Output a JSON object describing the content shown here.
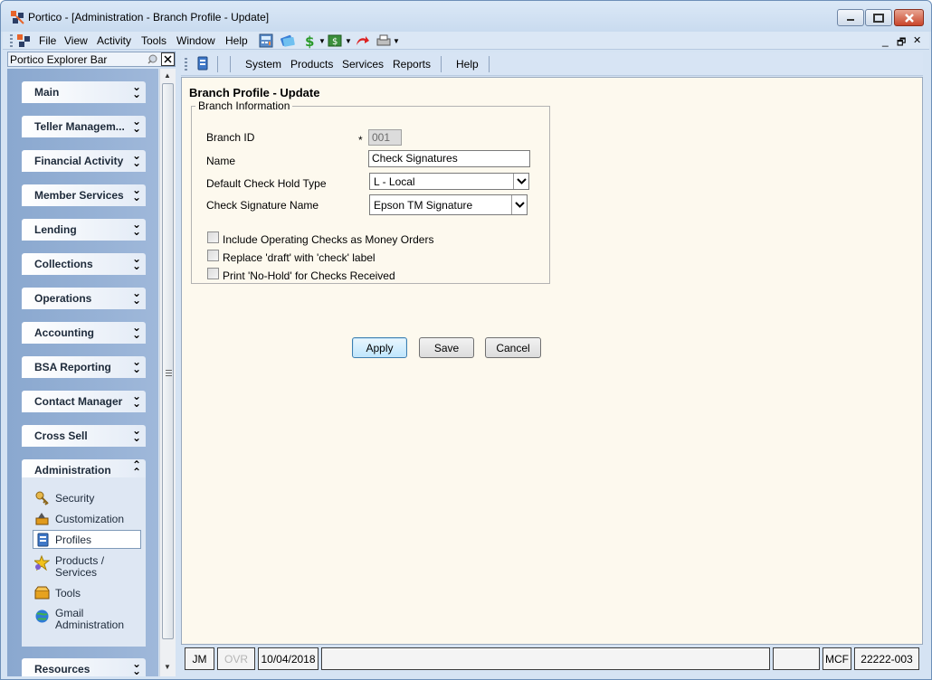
{
  "window": {
    "title": "Portico - [Administration - Branch Profile - Update]"
  },
  "menubar": {
    "items": [
      "File",
      "View",
      "Activity",
      "Tools",
      "Window",
      "Help"
    ],
    "mdi_minimize": "_",
    "mdi_restore": "🗗",
    "mdi_close": "✕"
  },
  "explorer": {
    "title": "Portico Explorer Bar",
    "sections": [
      "Main",
      "Teller Managem...",
      "Financial Activity",
      "Member Services",
      "Lending",
      "Collections",
      "Operations",
      "Accounting",
      "BSA Reporting",
      "Contact Manager",
      "Cross Sell",
      "Administration",
      "Resources"
    ],
    "expanded_section": "Administration",
    "admin_items": [
      {
        "label": "Security",
        "icon": "security-icon"
      },
      {
        "label": "Customization",
        "icon": "customization-icon"
      },
      {
        "label": "Profiles",
        "icon": "profiles-icon"
      },
      {
        "label": "Products /\nServices",
        "icon": "products-services-icon"
      },
      {
        "label": "Tools",
        "icon": "tools-icon"
      },
      {
        "label": "Gmail\nAdministration",
        "icon": "gmail-administration-icon"
      }
    ],
    "selected_item": "Profiles"
  },
  "toolbar2": {
    "items": [
      "System",
      "Products",
      "Services",
      "Reports",
      "Help"
    ]
  },
  "page": {
    "title": "Branch Profile - Update",
    "group_title": "Branch Information",
    "branch_id_label": "Branch ID",
    "branch_id_value": "001",
    "required_marker": "*",
    "name_label": "Name",
    "name_value": "Check Signatures",
    "hold_type_label": "Default Check Hold Type",
    "hold_type_value": "L - Local",
    "signature_label": "Check Signature Name",
    "signature_value": "Epson TM Signature",
    "checkboxes": [
      {
        "label": "Include Operating Checks as Money Orders",
        "checked": false
      },
      {
        "label": "Replace 'draft' with 'check' label",
        "checked": false
      },
      {
        "label": "Print 'No-Hold' for Checks Received",
        "checked": false
      }
    ],
    "buttons": {
      "apply": "Apply",
      "save": "Save",
      "cancel": "Cancel"
    }
  },
  "status": {
    "user": "JM",
    "ovr": "OVR",
    "date": "10/04/2018",
    "field1": "",
    "field2": "",
    "mcf": "MCF",
    "code": "22222-003"
  },
  "colors": {
    "content_bg": "#fdf9ee",
    "explorer_bg": "#9fb8da",
    "default_button": "#bee6fd"
  }
}
